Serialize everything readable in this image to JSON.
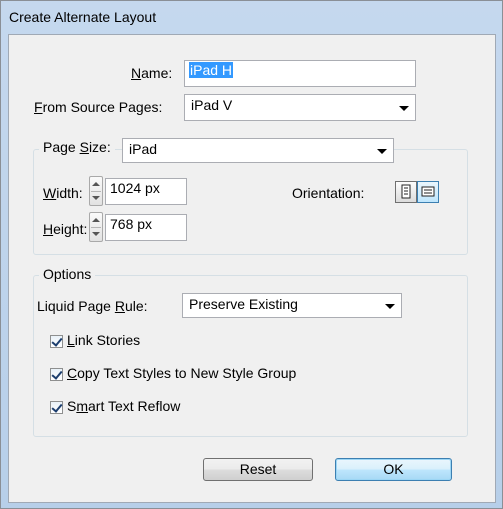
{
  "window": {
    "title": "Create Alternate Layout"
  },
  "name": {
    "label_pre": "",
    "label_ul": "N",
    "label_post": "ame:",
    "value": "iPad H"
  },
  "from_source_pages": {
    "label_ul": "F",
    "label_post": "rom Source Pages:",
    "value": "iPad V"
  },
  "page_size": {
    "label_pre": "Page ",
    "label_ul": "S",
    "label_post": "ize:",
    "value": "iPad",
    "width": {
      "label_ul": "W",
      "label_post": "idth:",
      "value": "1024 px"
    },
    "height": {
      "label_ul": "H",
      "label_post": "eight:",
      "value": "768 px"
    },
    "orientation_label": "Orientation:",
    "orientation": {
      "portrait_icon": "portrait-icon",
      "landscape_icon": "landscape-icon",
      "selected": "landscape"
    }
  },
  "options": {
    "title": "Options",
    "liquid_rule": {
      "label_pre": "Liquid Page ",
      "label_ul": "R",
      "label_post": "ule:",
      "value": "Preserve Existing"
    },
    "checkboxes": [
      {
        "pre": "",
        "ul": "L",
        "post": "ink Stories",
        "checked": true
      },
      {
        "pre": "",
        "ul": "C",
        "post": "opy Text Styles to New Style Group",
        "checked": true
      },
      {
        "pre": "S",
        "ul": "m",
        "post": "art Text Reflow",
        "checked": true
      }
    ]
  },
  "buttons": {
    "reset": "Reset",
    "ok": "OK"
  }
}
